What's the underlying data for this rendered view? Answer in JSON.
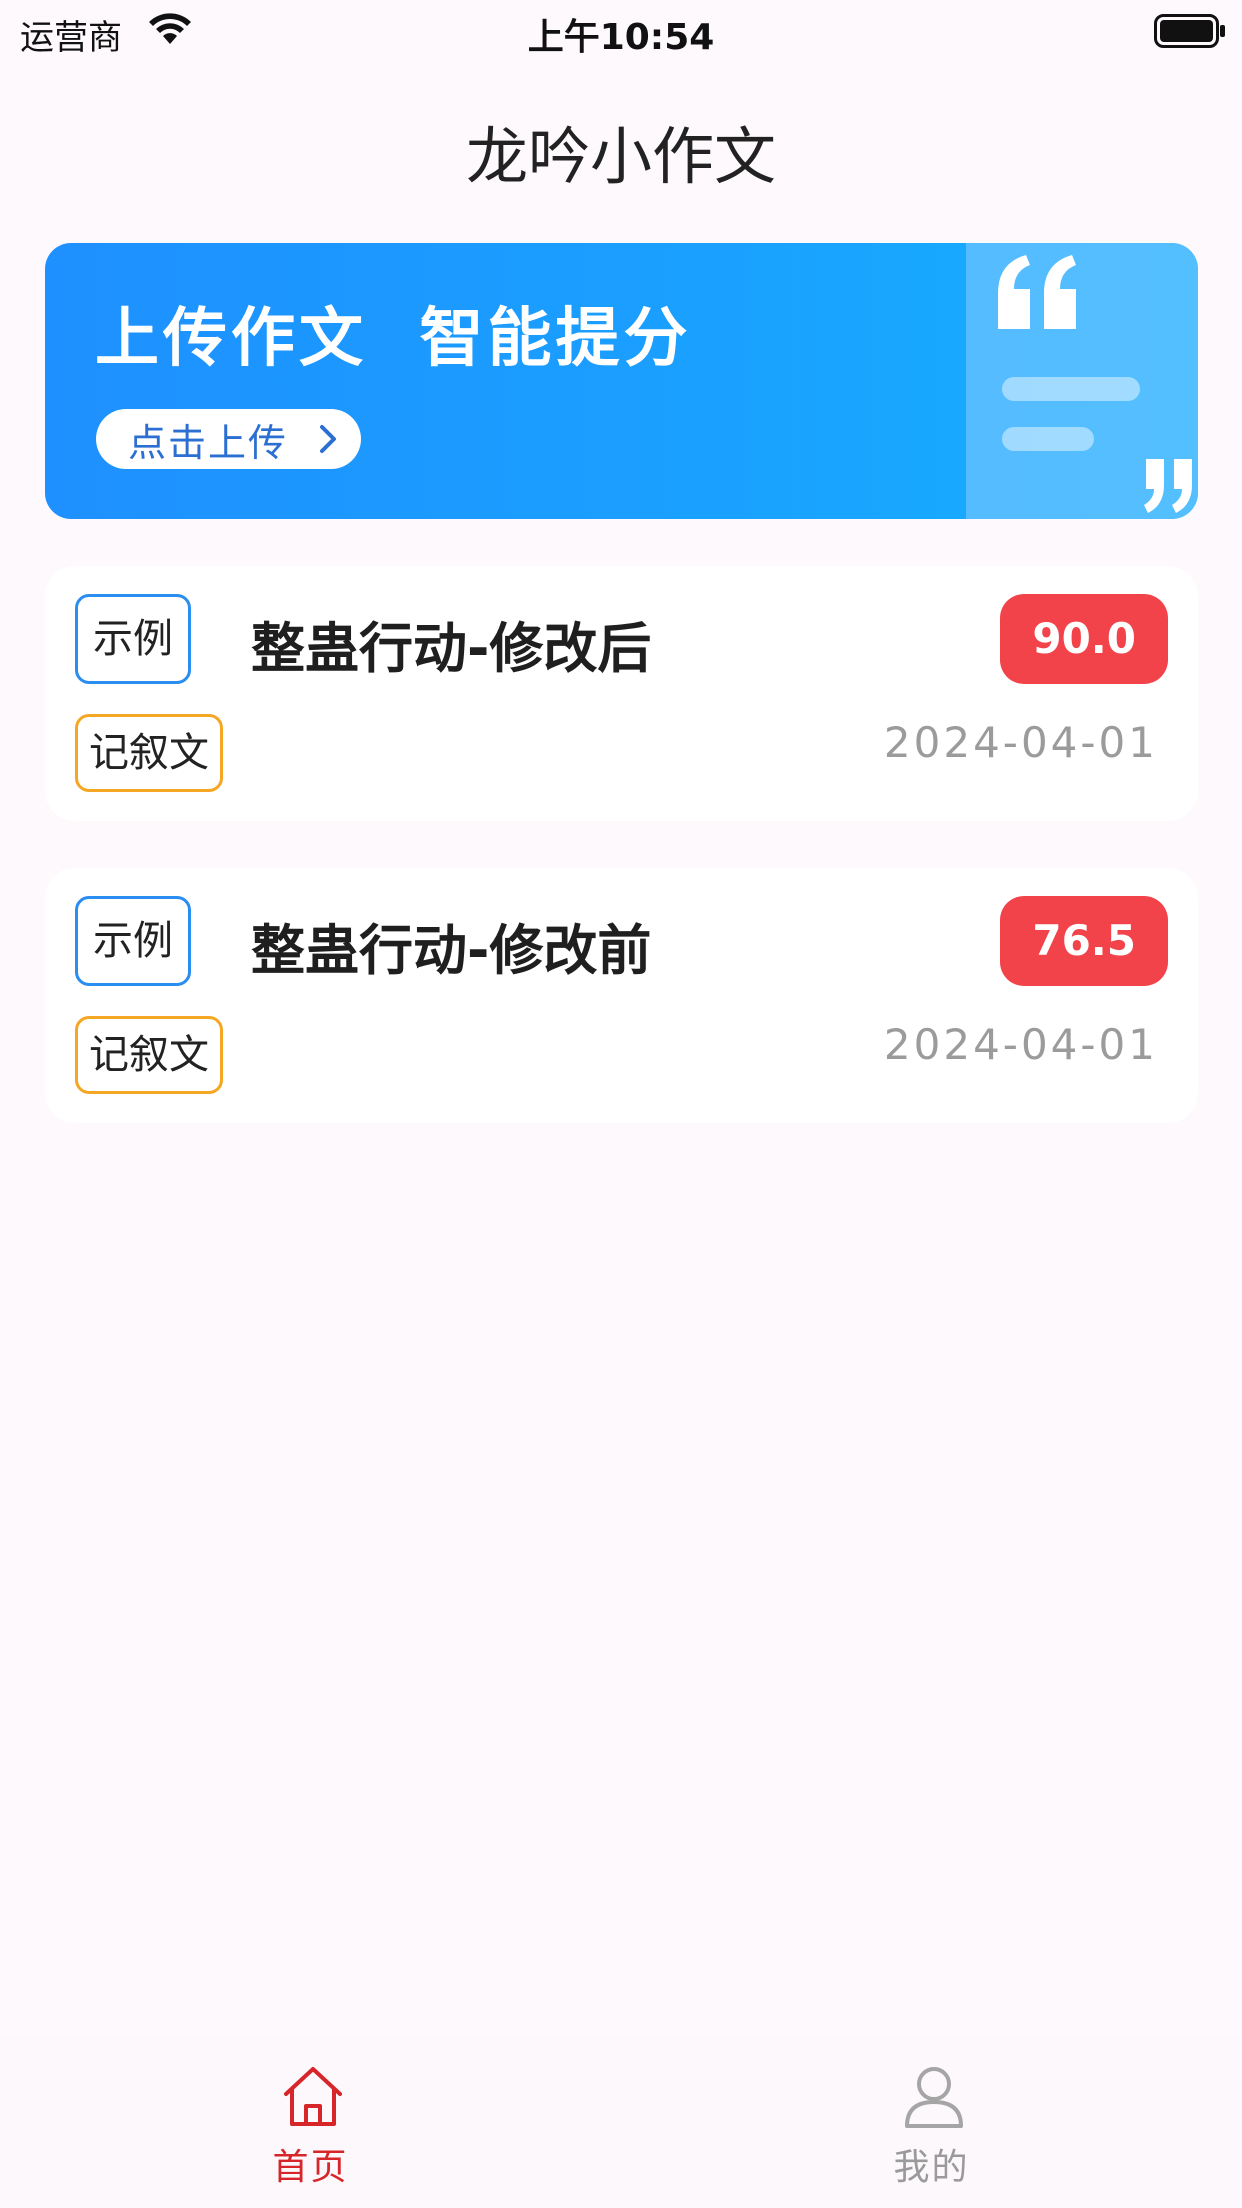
{
  "status_bar": {
    "carrier": "运营商",
    "time": "上午10:54"
  },
  "nav": {
    "title": "龙吟小作文"
  },
  "banner": {
    "headline": "上传作文  智能提分",
    "button_label": "点击上传",
    "button_icon": "chevron-right-icon",
    "decor_icon": "quote-icon",
    "background_color": "#1e90ff"
  },
  "essays": [
    {
      "tag": "示例",
      "genre": "记叙文",
      "title": "整蛊行动-修改后",
      "score": "90.0",
      "date": "2024-04-01"
    },
    {
      "tag": "示例",
      "genre": "记叙文",
      "title": "整蛊行动-修改前",
      "score": "76.5",
      "date": "2024-04-01"
    }
  ],
  "tab_bar": {
    "items": [
      {
        "label": "首页",
        "icon": "home-icon",
        "active": true,
        "color": "#d7262a"
      },
      {
        "label": "我的",
        "icon": "user-icon",
        "active": false,
        "color": "#9a9a9a"
      }
    ]
  },
  "colors": {
    "score_badge": "#f3434a",
    "tag_example_border": "#2a8df0",
    "tag_genre_border": "#f5a623",
    "page_background": "#fdf9fc"
  }
}
